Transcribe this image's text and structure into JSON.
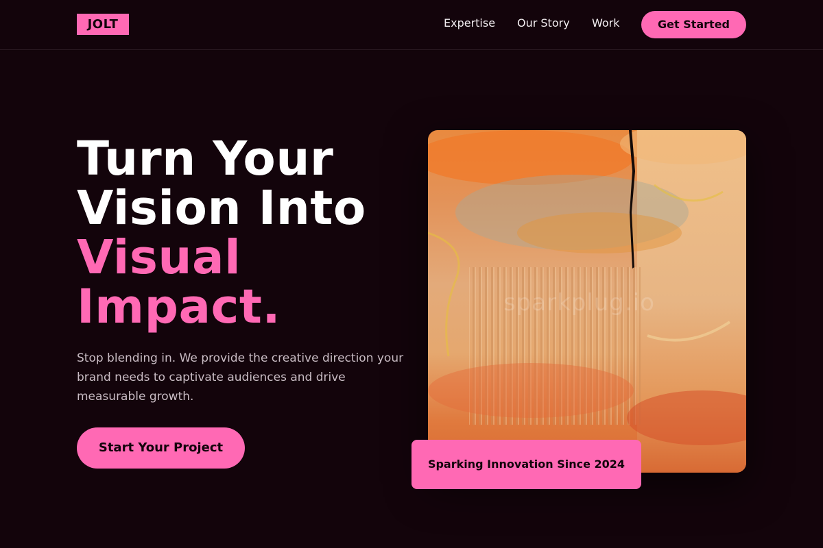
{
  "nav": {
    "logo": "JOLT",
    "links": [
      "Expertise",
      "Our Story",
      "Work"
    ],
    "cta": "Get Started"
  },
  "hero": {
    "headline_white_1": "Turn Your",
    "headline_white_2": "Vision Into",
    "headline_pink_1": "Visual",
    "headline_pink_2": "Impact.",
    "subtitle": "Stop blending in. We provide the creative direction your brand needs to captivate audiences and drive measurable growth.",
    "cta": "Start Your Project"
  },
  "artwork": {
    "watermark": "sparkplug.io",
    "badge": "Sparking Innovation Since 2024"
  },
  "colors": {
    "background": "#13040b",
    "accent": "#ff69b4"
  }
}
